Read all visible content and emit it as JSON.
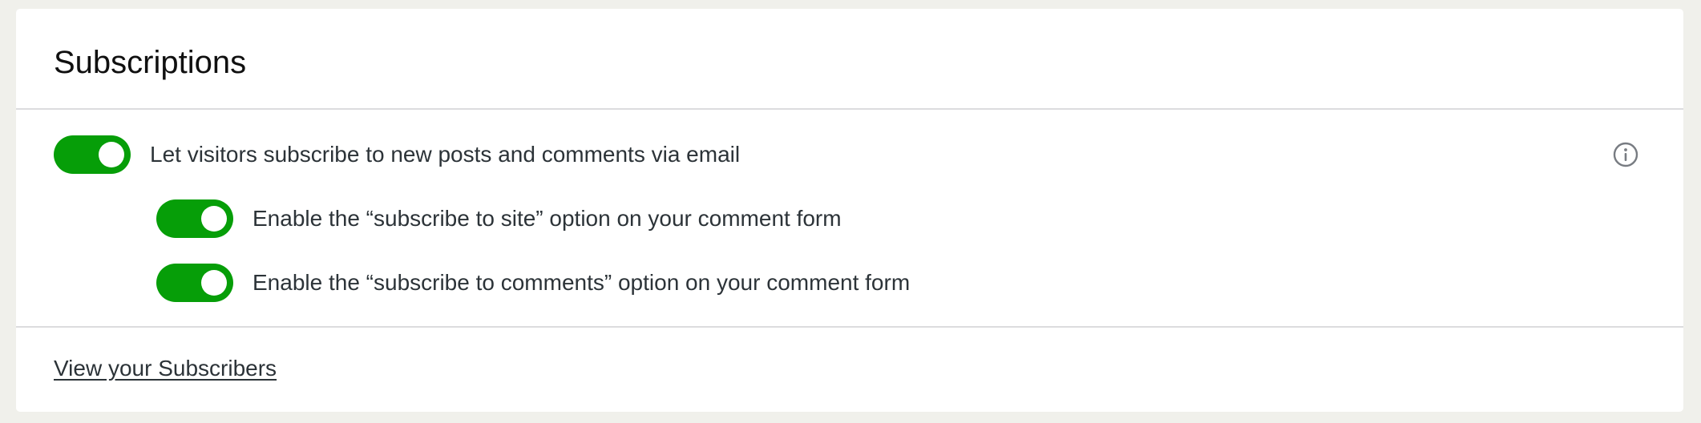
{
  "card": {
    "title": "Subscriptions"
  },
  "settings": {
    "main_toggle": {
      "label": "Let visitors subscribe to new posts and comments via email",
      "enabled": true
    },
    "site_toggle": {
      "label": "Enable the “subscribe to site” option on your comment form",
      "enabled": true
    },
    "comments_toggle": {
      "label": "Enable the “subscribe to comments” option on your comment form",
      "enabled": true
    },
    "info_icon": "info-circle-icon"
  },
  "footer": {
    "link_label": "View your Subscribers"
  },
  "colors": {
    "toggle_on": "#069e08",
    "text": "#2c3338",
    "divider": "#dcdcde",
    "background": "#f0f0eb"
  }
}
